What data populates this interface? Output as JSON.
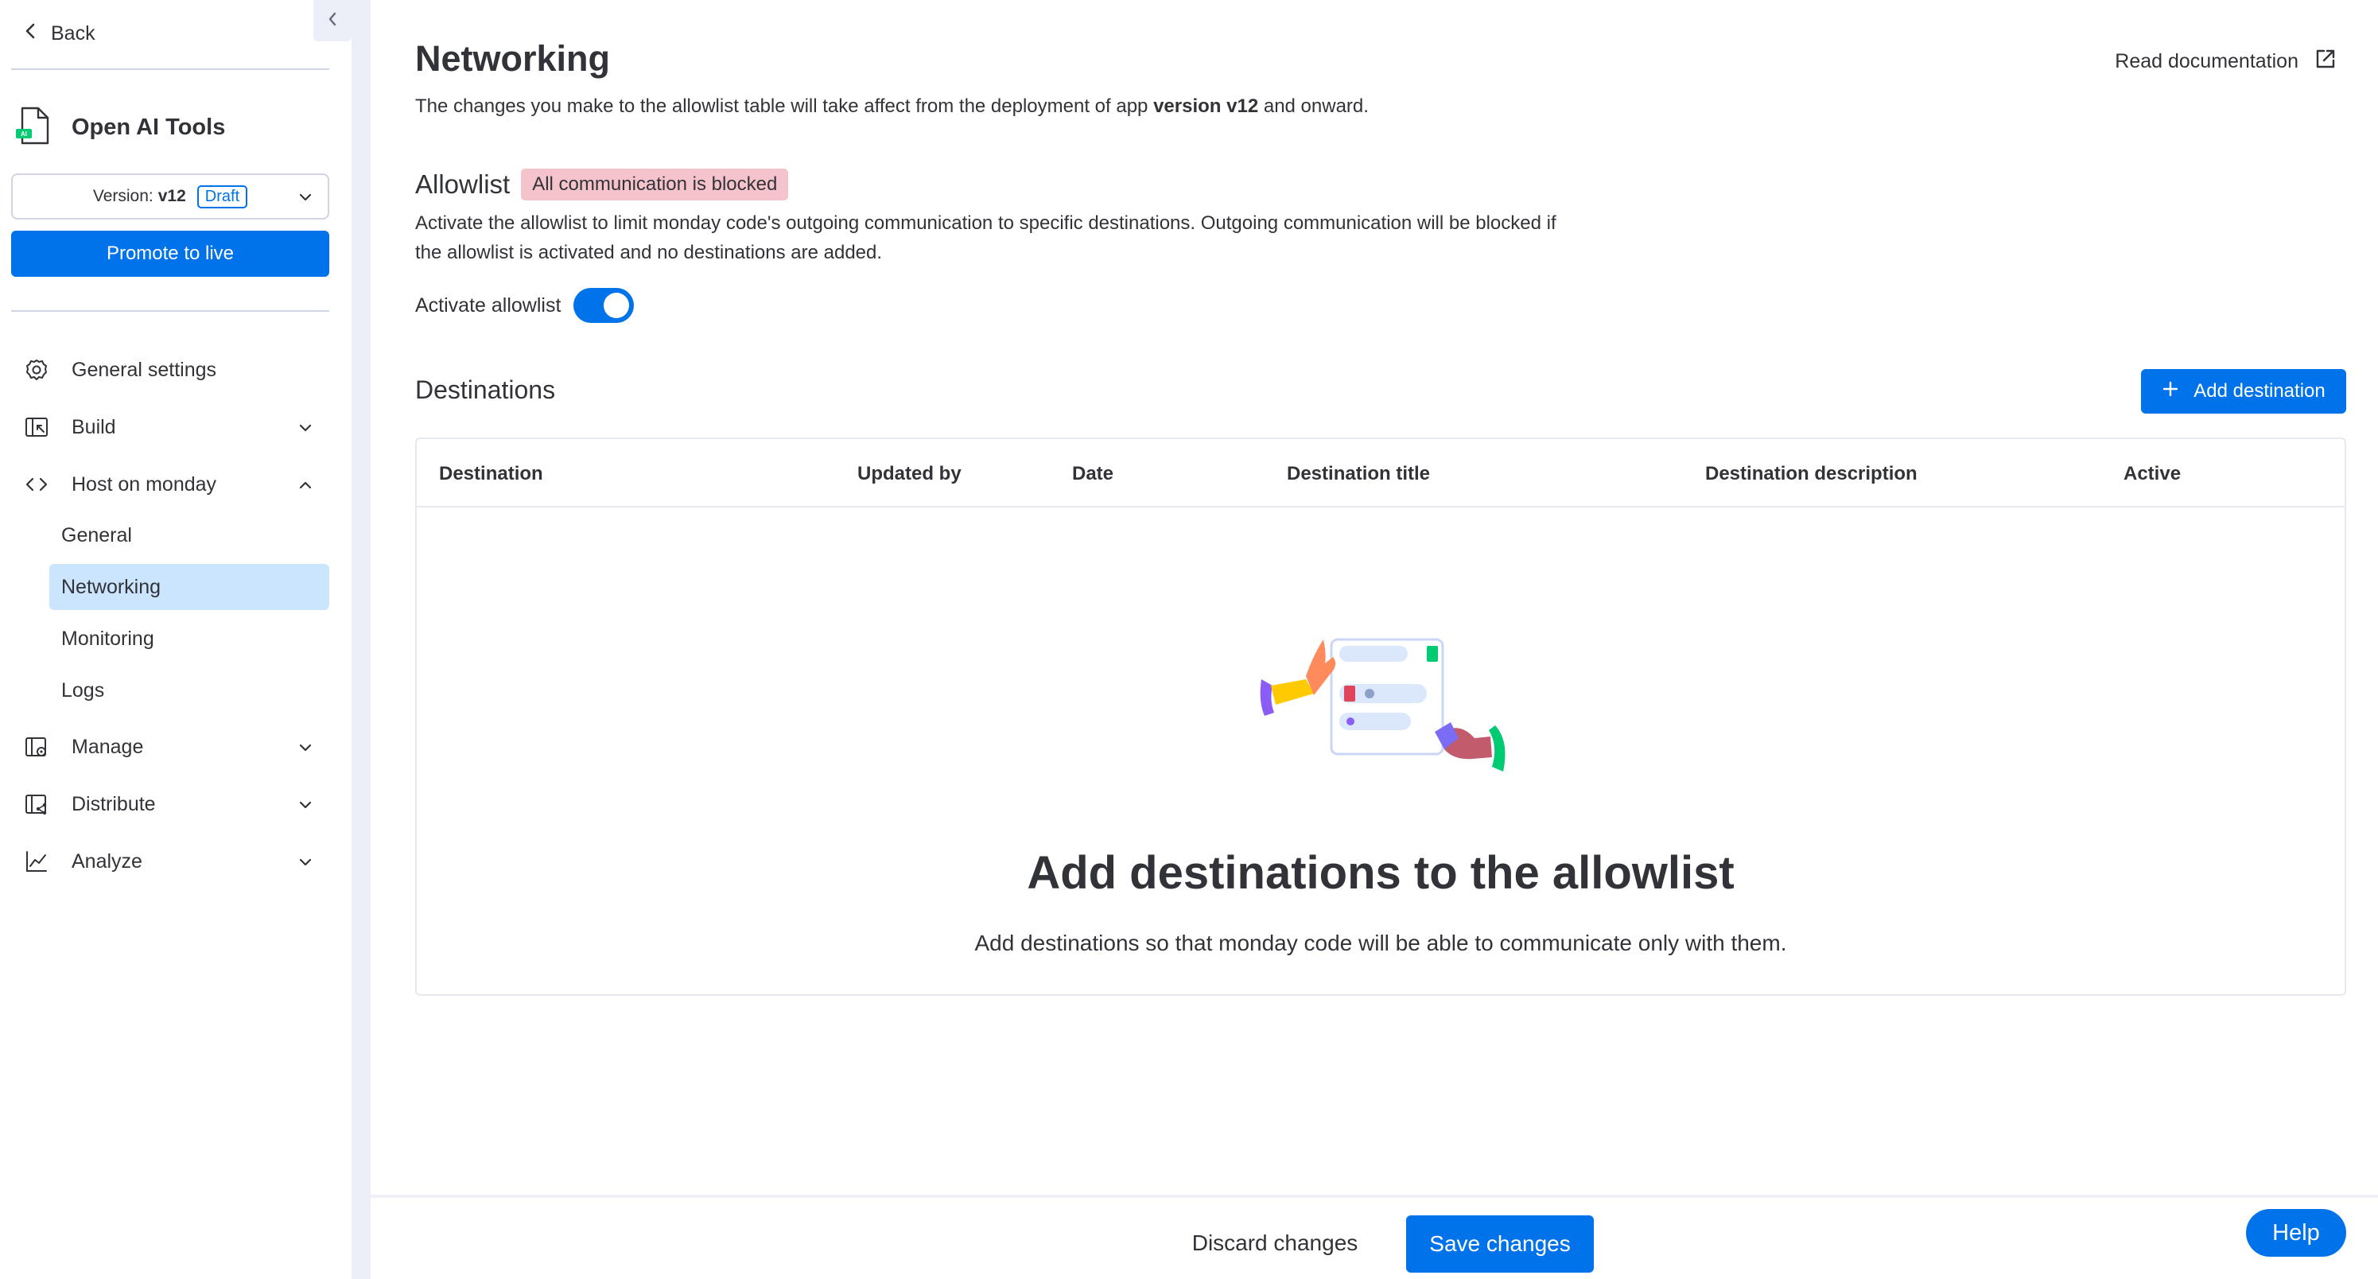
{
  "sidebar": {
    "back_label": "Back",
    "app_name": "Open AI Tools",
    "version_label": "Version:",
    "version_value": "v12",
    "draft_label": "Draft",
    "promote_label": "Promote to live",
    "nav": {
      "general_settings": "General settings",
      "build": "Build",
      "host_on_monday": "Host on monday",
      "sub_general": "General",
      "sub_networking": "Networking",
      "sub_monitoring": "Monitoring",
      "sub_logs": "Logs",
      "manage": "Manage",
      "distribute": "Distribute",
      "analyze": "Analyze"
    }
  },
  "main": {
    "title": "Networking",
    "read_docs": "Read documentation",
    "desc_pre": "The changes you make to the allowlist table will take affect from the deployment of app ",
    "desc_bold": "version v12",
    "desc_post": " and onward.",
    "allowlist_title": "Allowlist",
    "blocked_badge": "All communication is blocked",
    "allowlist_desc": "Activate the allowlist to limit monday code's outgoing communication to specific destinations. Outgoing communication will be blocked if the allowlist is activated and no destinations are added.",
    "activate_label": "Activate allowlist",
    "destinations_title": "Destinations",
    "add_destination": "Add destination",
    "table_headers": {
      "destination": "Destination",
      "updated_by": "Updated by",
      "date": "Date",
      "destination_title": "Destination title",
      "destination_description": "Destination description",
      "active": "Active"
    },
    "empty_title": "Add destinations to the allowlist",
    "empty_desc": "Add destinations so that monday code will be able to communicate only with them."
  },
  "footer": {
    "discard": "Discard changes",
    "save": "Save changes",
    "help": "Help"
  },
  "colors": {
    "accent": "#0073ea",
    "selected": "#cce5ff",
    "blocked_badge": "#f4c3cb",
    "text": "#323338",
    "border": "#d0d4e4"
  }
}
